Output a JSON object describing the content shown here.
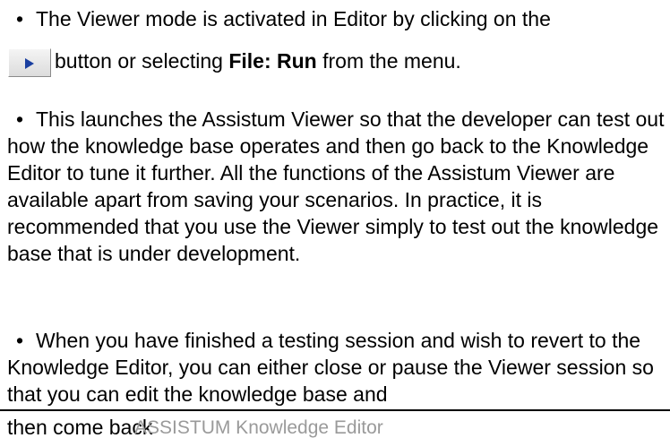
{
  "paragraphs": {
    "p1": {
      "line1": "The Viewer mode is activated in Editor by clicking on the",
      "line2_after_button": "button or selecting ",
      "line2_bold": "File: Run",
      "line2_end": " from the menu.",
      "button_icon": "play-arrow-icon"
    },
    "p2": {
      "text": "This launches the Assistum Viewer so that the developer can test out how the knowledge base operates and then go back to the Knowledge Editor to tune it further. All the functions of the Assistum Viewer are available apart from saving your scenarios. In practice, it is recommended that you use the Viewer simply to test out the knowledge base that is under development."
    },
    "p3": {
      "text": "When you have finished a testing session and wish to revert to the Knowledge Editor, you can either close or pause the Viewer session so that you can edit the knowledge base and",
      "tail": "then come back"
    }
  },
  "bullet_symbol": "•",
  "footer": {
    "title": "ASSISTUM Knowledge Editor"
  },
  "colors": {
    "text": "#000000",
    "footer_text": "#9a9a9a",
    "button_arrow": "#1a3fa0"
  }
}
